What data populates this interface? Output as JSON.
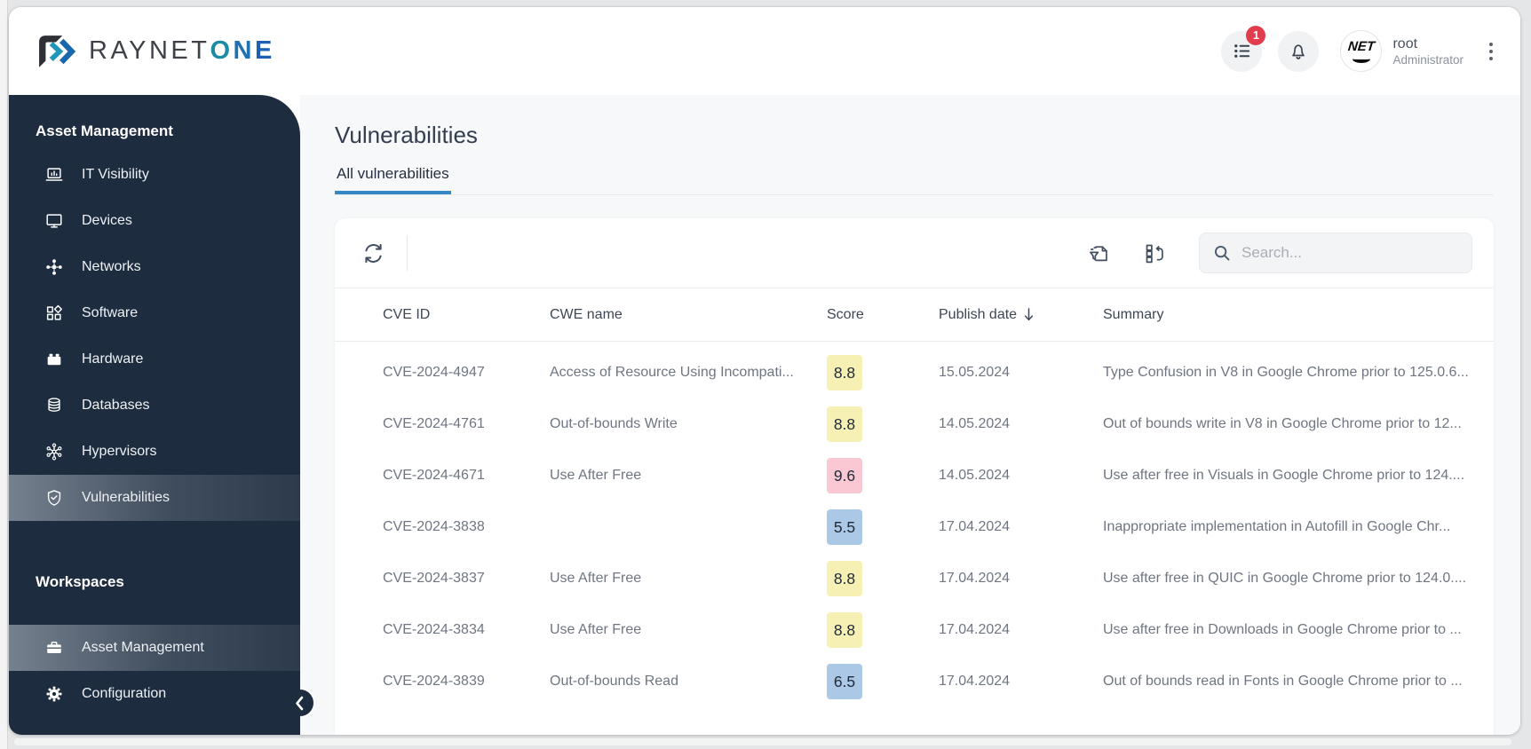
{
  "brand": {
    "primary": "RAYNET",
    "accent": "ONE"
  },
  "header": {
    "notification_badge": "1",
    "user": {
      "name": "root",
      "role": "Administrator",
      "avatar_text": "NET"
    }
  },
  "sidebar": {
    "sections": [
      {
        "title": "Asset Management",
        "items": [
          {
            "slug": "it-visibility",
            "icon": "laptop-chart",
            "label": "IT Visibility",
            "active": false
          },
          {
            "slug": "devices",
            "icon": "monitor",
            "label": "Devices",
            "active": false
          },
          {
            "slug": "networks",
            "icon": "network",
            "label": "Networks",
            "active": false
          },
          {
            "slug": "software",
            "icon": "software-boxes",
            "label": "Software",
            "active": false
          },
          {
            "slug": "hardware",
            "icon": "brick",
            "label": "Hardware",
            "active": false
          },
          {
            "slug": "databases",
            "icon": "database",
            "label": "Databases",
            "active": false
          },
          {
            "slug": "hypervisors",
            "icon": "asterisk-nodes",
            "label": "Hypervisors",
            "active": false
          },
          {
            "slug": "vulnerabilities",
            "icon": "shield-check",
            "label": "Vulnerabilities",
            "active": true
          }
        ]
      },
      {
        "title": "Workspaces",
        "items": [
          {
            "slug": "asset-management",
            "icon": "briefcase",
            "label": "Asset Management",
            "active": true
          },
          {
            "slug": "configuration",
            "icon": "gear",
            "label": "Configuration",
            "active": false
          }
        ]
      }
    ]
  },
  "page": {
    "title": "Vulnerabilities",
    "tabs": [
      {
        "label": "All vulnerabilities",
        "active": true
      }
    ]
  },
  "toolbar": {
    "search_placeholder": "Search..."
  },
  "table": {
    "columns": [
      "CVE ID",
      "CWE name",
      "Score",
      "Publish date",
      "Summary"
    ],
    "sort": {
      "column": "Publish date",
      "direction": "desc"
    },
    "rows": [
      {
        "cve_id": "CVE-2024-4947",
        "cwe_name": "Access of Resource Using Incompati...",
        "score": "8.8",
        "score_level": "high",
        "publish_date": "15.05.2024",
        "summary": "Type Confusion in V8 in Google Chrome prior to 125.0.6..."
      },
      {
        "cve_id": "CVE-2024-4761",
        "cwe_name": "Out-of-bounds Write",
        "score": "8.8",
        "score_level": "high",
        "publish_date": "14.05.2024",
        "summary": "Out of bounds write in V8 in Google Chrome prior to 12..."
      },
      {
        "cve_id": "CVE-2024-4671",
        "cwe_name": "Use After Free",
        "score": "9.6",
        "score_level": "critical",
        "publish_date": "14.05.2024",
        "summary": "Use after free in Visuals in Google Chrome prior to 124...."
      },
      {
        "cve_id": "CVE-2024-3838",
        "cwe_name": "",
        "score": "5.5",
        "score_level": "medium",
        "publish_date": "17.04.2024",
        "summary": "Inappropriate implementation in Autofill in Google Chr..."
      },
      {
        "cve_id": "CVE-2024-3837",
        "cwe_name": "Use After Free",
        "score": "8.8",
        "score_level": "high",
        "publish_date": "17.04.2024",
        "summary": "Use after free in QUIC in Google Chrome prior to 124.0...."
      },
      {
        "cve_id": "CVE-2024-3834",
        "cwe_name": "Use After Free",
        "score": "8.8",
        "score_level": "high",
        "publish_date": "17.04.2024",
        "summary": "Use after free in Downloads in Google Chrome prior to ..."
      },
      {
        "cve_id": "CVE-2024-3839",
        "cwe_name": "Out-of-bounds Read",
        "score": "6.5",
        "score_level": "medium",
        "publish_date": "17.04.2024",
        "summary": "Out of bounds read in Fonts in Google Chrome prior to ..."
      }
    ]
  },
  "colors": {
    "score_high": "#f6f0b5",
    "score_critical": "#f9c8d3",
    "score_medium": "#abc8e6",
    "accent_blue": "#3489c4",
    "sidebar_bg": "#1d2c3f",
    "badge_red": "#e23c4f"
  }
}
